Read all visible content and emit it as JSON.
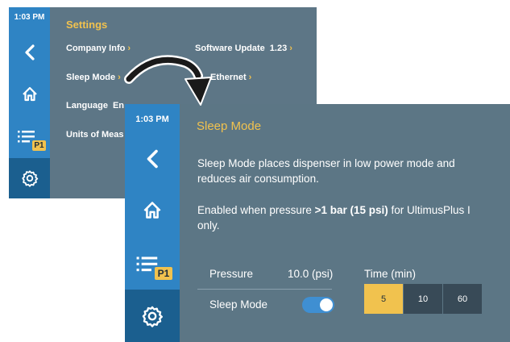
{
  "back_screen": {
    "time": "1:03 PM",
    "title": "Settings",
    "items": {
      "company_info": "Company Info",
      "sleep_mode": "Sleep Mode",
      "language": "Language",
      "language_value": "En",
      "units": "Units of Meas",
      "software_update": "Software Update",
      "software_version": "1.23",
      "ethernet": "Ethernet"
    },
    "chevron": "›",
    "badge": "P1"
  },
  "front_screen": {
    "time": "1:03 PM",
    "title": "Sleep Mode",
    "description_line1": "Sleep Mode places dispenser in low power mode and",
    "description_line2": "reduces air consumption.",
    "enabled_prefix": "Enabled when pressure ",
    "enabled_bold": ">1 bar (15 psi)",
    "enabled_suffix": " for UltimusPlus I",
    "enabled_line2": "only.",
    "pressure_label": "Pressure",
    "pressure_value": "10.0 (psi)",
    "sleep_mode_label": "Sleep Mode",
    "sleep_mode_enabled": true,
    "time_label": "Time (min)",
    "time_options": [
      "5",
      "10",
      "60"
    ],
    "time_selected": "5",
    "badge": "P1"
  },
  "icons": [
    "back-icon",
    "home-icon",
    "program-list-icon",
    "gear-icon",
    "curved-arrow-icon"
  ],
  "colors": {
    "panel": "#5d7686",
    "sidebar": "#2f84c4",
    "sidebar_selected": "#1b5f8f",
    "accent": "#f1c24e",
    "segment_off": "#384a57",
    "toggle_on": "#3f8fd2"
  }
}
